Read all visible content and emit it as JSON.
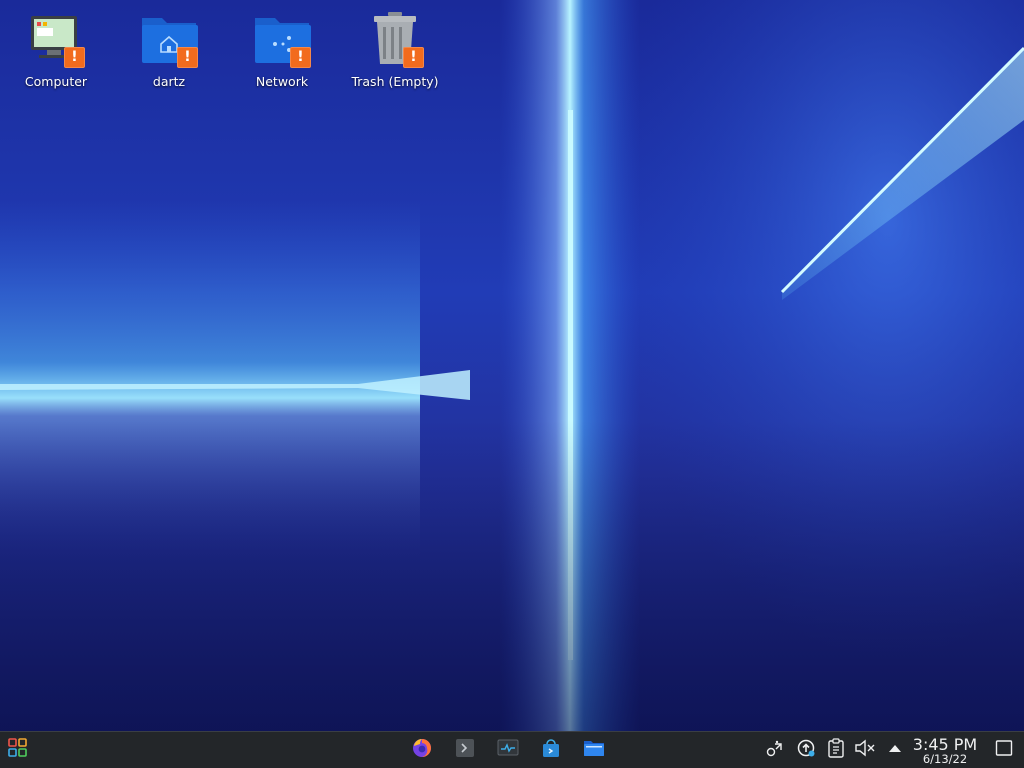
{
  "desktop": {
    "icons": [
      {
        "label": "Computer",
        "icon": "computer-icon",
        "badge": "!"
      },
      {
        "label": "dartz",
        "icon": "home-folder-icon",
        "badge": "!"
      },
      {
        "label": "Network",
        "icon": "network-folder-icon",
        "badge": "!"
      },
      {
        "label": "Trash (Empty)",
        "icon": "trash-icon",
        "badge": "!"
      }
    ]
  },
  "taskbar": {
    "launcher_icon": "app-launcher-icon",
    "tasks": [
      {
        "icon": "firefox-icon"
      },
      {
        "icon": "terminal-icon"
      },
      {
        "icon": "system-monitor-icon"
      },
      {
        "icon": "discover-store-icon"
      },
      {
        "icon": "file-manager-icon"
      }
    ],
    "tray": [
      {
        "icon": "network-icon"
      },
      {
        "icon": "updates-icon"
      },
      {
        "icon": "clipboard-icon"
      },
      {
        "icon": "volume-muted-icon"
      },
      {
        "icon": "expand-tray-icon"
      }
    ],
    "clock": {
      "time": "3:45 PM",
      "date": "6/13/22"
    },
    "show_desktop_icon": "show-desktop-icon"
  },
  "colors": {
    "taskbar_bg": "#232629",
    "folder_blue": "#1d6fe0",
    "warning_orange": "#f26b1d",
    "light_beam": "#6fe6ff"
  }
}
